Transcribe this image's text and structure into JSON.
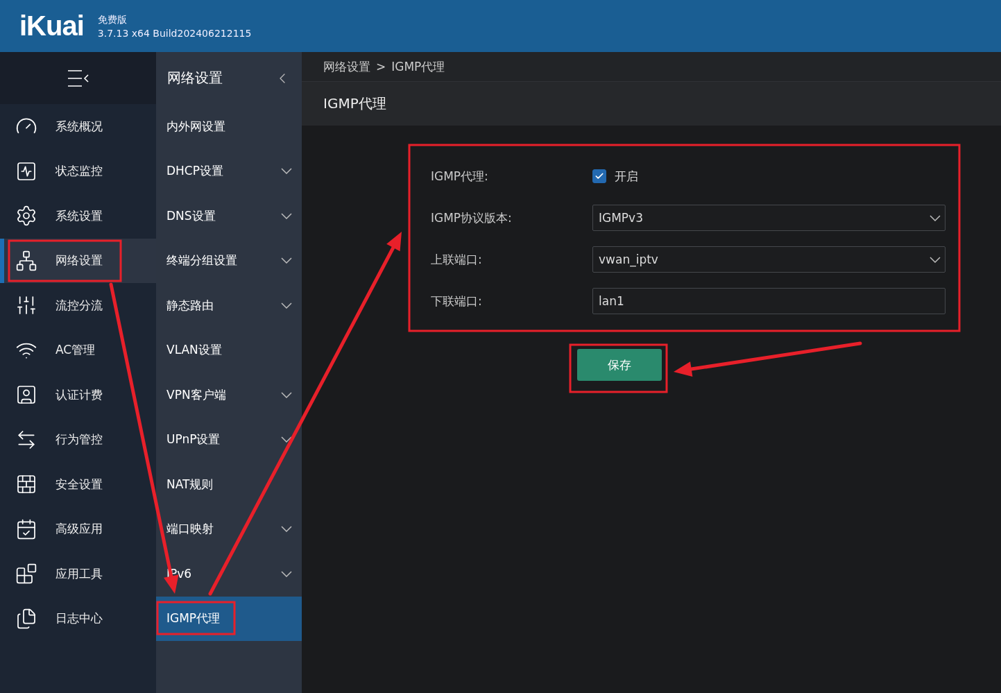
{
  "header": {
    "logo": "iKuai",
    "edition": "免费版",
    "version": "3.7.13 x64 Build202406212115"
  },
  "sidebar": {
    "items": [
      {
        "label": "系统概况",
        "selected": false
      },
      {
        "label": "状态监控",
        "selected": false
      },
      {
        "label": "系统设置",
        "selected": false
      },
      {
        "label": "网络设置",
        "selected": true
      },
      {
        "label": "流控分流",
        "selected": false
      },
      {
        "label": "AC管理",
        "selected": false
      },
      {
        "label": "认证计费",
        "selected": false
      },
      {
        "label": "行为管控",
        "selected": false
      },
      {
        "label": "安全设置",
        "selected": false
      },
      {
        "label": "高级应用",
        "selected": false
      },
      {
        "label": "应用工具",
        "selected": false
      },
      {
        "label": "日志中心",
        "selected": false
      }
    ]
  },
  "submenu": {
    "title": "网络设置",
    "items": [
      {
        "label": "内外网设置",
        "kind": "link",
        "selected": false
      },
      {
        "label": "DHCP设置",
        "kind": "group",
        "selected": false
      },
      {
        "label": "DNS设置",
        "kind": "group",
        "selected": false
      },
      {
        "label": "终端分组设置",
        "kind": "group",
        "selected": false
      },
      {
        "label": "静态路由",
        "kind": "group",
        "selected": false
      },
      {
        "label": "VLAN设置",
        "kind": "link",
        "selected": false
      },
      {
        "label": "VPN客户端",
        "kind": "group",
        "selected": false
      },
      {
        "label": "UPnP设置",
        "kind": "group",
        "selected": false
      },
      {
        "label": "NAT规则",
        "kind": "link",
        "selected": false
      },
      {
        "label": "端口映射",
        "kind": "group",
        "selected": false
      },
      {
        "label": "IPv6",
        "kind": "group",
        "selected": false
      },
      {
        "label": "IGMP代理",
        "kind": "link",
        "selected": true
      }
    ]
  },
  "breadcrumb": [
    "网络设置",
    ">",
    "IGMP代理"
  ],
  "page_title": "IGMP代理",
  "form": {
    "fields": [
      {
        "label": "IGMP代理:",
        "kind": "checkbox",
        "checked": true,
        "text": "开启"
      },
      {
        "label": "IGMP协议版本:",
        "kind": "select",
        "value": "IGMPv3"
      },
      {
        "label": "上联端口:",
        "kind": "select",
        "value": "vwan_iptv"
      },
      {
        "label": "下联端口:",
        "kind": "input",
        "value": "lan1"
      }
    ],
    "save": "保存"
  }
}
